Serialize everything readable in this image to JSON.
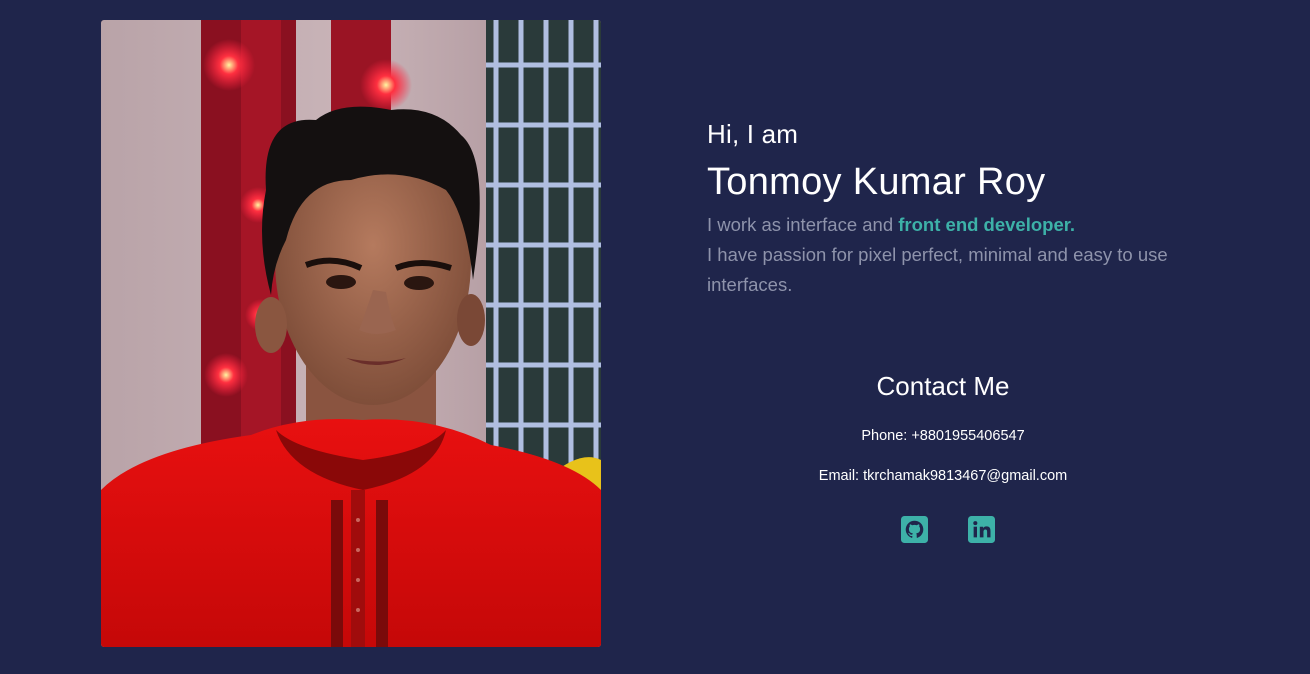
{
  "profile_photo": {
    "alt": "Portrait of Tonmoy Kumar Roy"
  },
  "intro": {
    "greeting": "Hi, I am",
    "name": "Tonmoy Kumar Roy",
    "bio_prefix": "I work as interface and ",
    "bio_accent": "front end developer.",
    "bio_line2": "I have passion for pixel perfect, minimal and easy to use interfaces."
  },
  "contact": {
    "title": "Contact Me",
    "phone": "Phone: +8801955406547",
    "email": "Email: tkrchamak9813467@gmail.com"
  },
  "socials": [
    {
      "icon": "github-icon"
    },
    {
      "icon": "linkedin-icon"
    }
  ],
  "colors": {
    "background": "#1f254b",
    "accent": "#3db1a8",
    "muted_text": "#8e93ab"
  }
}
